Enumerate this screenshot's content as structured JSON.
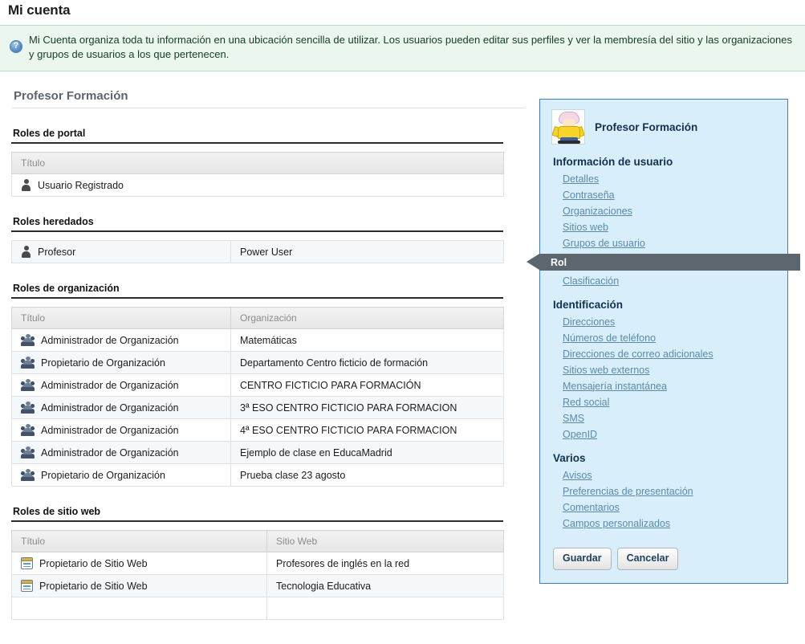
{
  "page": {
    "title": "Mi cuenta",
    "info_message": "Mi Cuenta organiza toda tu información en una ubicación sencilla de utilizar. Los usuarios pueden editar sus perfiles y ver la membresía del sitio y las organizaciones y grupos de usuarios a los que pertenecen.",
    "info_icon": "help-circle-icon",
    "user_heading": "Profesor Formación"
  },
  "sections": {
    "portal_roles": {
      "title": "Roles de portal",
      "columns": [
        "Título"
      ],
      "rows": [
        {
          "icon": "person-icon",
          "title": "Usuario Registrado"
        }
      ]
    },
    "inherited_roles": {
      "title": "Roles heredados",
      "columns": [],
      "rows": [
        {
          "icon": "person-icon",
          "title": "Profesor",
          "value": "Power User"
        }
      ]
    },
    "organization_roles": {
      "title": "Roles de organización",
      "columns": [
        "Título",
        "Organización"
      ],
      "rows": [
        {
          "icon": "group-icon",
          "title": "Administrador de Organización",
          "value": "Matemáticas"
        },
        {
          "icon": "group-icon",
          "title": "Propietario de Organización",
          "value": "Departamento Centro ficticio de formación"
        },
        {
          "icon": "group-icon",
          "title": "Administrador de Organización",
          "value": "CENTRO FICTICIO PARA FORMACIÓN"
        },
        {
          "icon": "group-icon",
          "title": "Administrador de Organización",
          "value": "3ª ESO CENTRO FICTICIO PARA FORMACION"
        },
        {
          "icon": "group-icon",
          "title": "Administrador de Organización",
          "value": "4ª ESO CENTRO FICTICIO PARA FORMACION"
        },
        {
          "icon": "group-icon",
          "title": "Administrador de Organización",
          "value": "Ejemplo de clase en EducaMadrid"
        },
        {
          "icon": "group-icon",
          "title": "Propietario de Organización",
          "value": "Prueba clase 23 agosto"
        }
      ]
    },
    "site_roles": {
      "title": "Roles de sitio web",
      "columns": [
        "Título",
        "Sitio Web"
      ],
      "rows": [
        {
          "icon": "site-icon",
          "title": "Propietario de Sitio Web",
          "value": "Profesores de inglés en la red"
        },
        {
          "icon": "site-icon",
          "title": "Propietario de Sitio Web",
          "value": "Tecnologia Educativa"
        },
        {
          "icon": "site-icon",
          "title": "",
          "value": ""
        }
      ]
    }
  },
  "sidebar": {
    "user_name": "Profesor Formación",
    "avatar_icon": "user-avatar-image",
    "groups": [
      {
        "title": "Información de usuario",
        "items": [
          {
            "label": "Detalles",
            "selected": false
          },
          {
            "label": "Contraseña",
            "selected": false
          },
          {
            "label": "Organizaciones",
            "selected": false
          },
          {
            "label": "Sitios web",
            "selected": false
          },
          {
            "label": "Grupos de usuario",
            "selected": false
          },
          {
            "label": "Rol",
            "selected": true
          },
          {
            "label": "Clasificación",
            "selected": false
          }
        ]
      },
      {
        "title": "Identificación",
        "items": [
          {
            "label": "Direcciones",
            "selected": false
          },
          {
            "label": "Números de teléfono",
            "selected": false
          },
          {
            "label": "Direcciones de correo adicionales",
            "selected": false
          },
          {
            "label": "Sitios web externos",
            "selected": false
          },
          {
            "label": "Mensajería instantánea",
            "selected": false
          },
          {
            "label": "Red social",
            "selected": false
          },
          {
            "label": "SMS",
            "selected": false
          },
          {
            "label": "OpenID",
            "selected": false
          }
        ]
      },
      {
        "title": "Varios",
        "items": [
          {
            "label": "Avisos",
            "selected": false
          },
          {
            "label": "Preferencias de presentación",
            "selected": false
          },
          {
            "label": "Comentarios",
            "selected": false
          },
          {
            "label": "Campos personalizados",
            "selected": false
          }
        ]
      }
    ],
    "save_label": "Guardar",
    "cancel_label": "Cancelar"
  },
  "colors": {
    "banner_bg": "#eaf6ee",
    "banner_border": "#b8dcc4",
    "panel_bg": "#d8eefb",
    "panel_border": "#3f7fbf",
    "selected_bg": "#5c666e",
    "link": "#5b8aa8",
    "heading": "#12324f"
  }
}
